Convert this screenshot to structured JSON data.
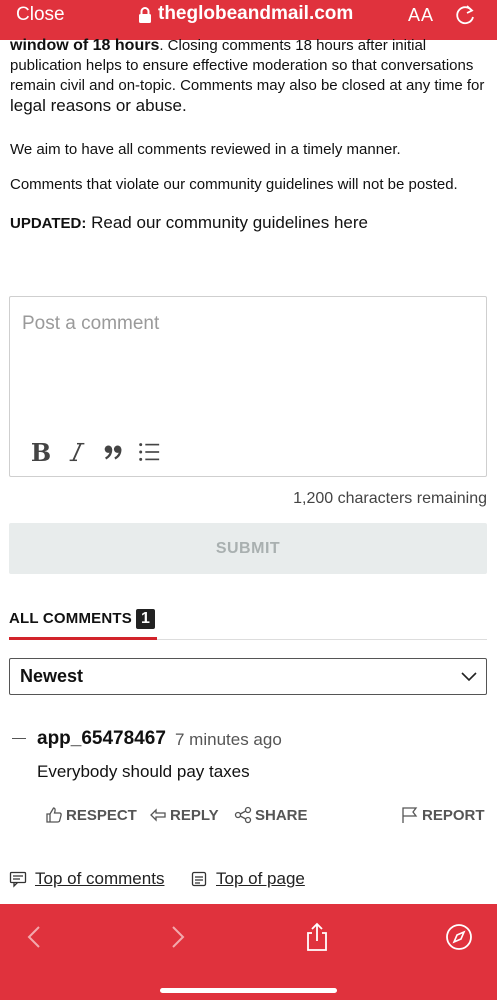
{
  "browser": {
    "close_label": "Close",
    "url": "theglobeandmail.com",
    "text_size_label": "AA"
  },
  "policy": {
    "line1_bold": "window of 18 hours",
    "line1_rest": ". Closing comments 18 hours after initial",
    "line2": "publication helps to ensure effective moderation so that conversations",
    "line3": "remain civil and on-topic. Comments may also be closed at any time for",
    "line4": "legal reasons or abuse.",
    "aim": "We aim to have all comments reviewed in a timely manner.",
    "violate": "Comments that violate our community guidelines will not be posted.",
    "updated_label": "UPDATED:",
    "updated_link": "Read our community guidelines here"
  },
  "composer": {
    "placeholder": "Post a comment",
    "chars_remaining": "1,200 characters remaining",
    "submit_label": "SUBMIT",
    "tools": [
      "B",
      "I",
      "99"
    ]
  },
  "comments_tab": {
    "label": "ALL COMMENTS",
    "count": "1"
  },
  "sort": {
    "selected": "Newest"
  },
  "comment": {
    "author": "app_65478467",
    "time": "7 minutes ago",
    "body": "Everybody should pay taxes",
    "actions": {
      "respect": "RESPECT",
      "reply": "REPLY",
      "share": "SHARE",
      "report": "REPORT"
    }
  },
  "links": {
    "top_comments": "Top of comments",
    "top_page": "Top of page"
  },
  "colors": {
    "brand_red": "#e0323d",
    "tab_underline": "#d2232a"
  }
}
